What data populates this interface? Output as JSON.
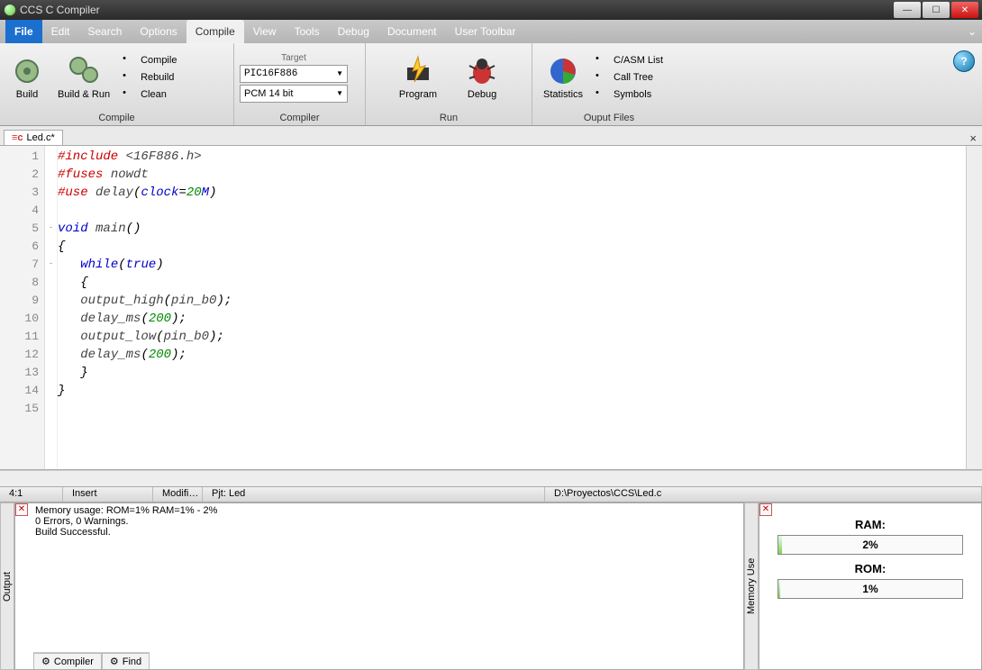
{
  "titlebar": {
    "title": "CCS C Compiler"
  },
  "menu": {
    "file": "File",
    "items": [
      "Edit",
      "Search",
      "Options",
      "Compile",
      "View",
      "Tools",
      "Debug",
      "Document",
      "User Toolbar"
    ],
    "active_index": 3
  },
  "ribbon": {
    "groups": {
      "compile": {
        "label": "Compile",
        "build": "Build",
        "build_run": "Build & Run",
        "small": [
          "Compile",
          "Rebuild",
          "Clean"
        ]
      },
      "compiler": {
        "label": "Compiler",
        "target_label": "Target",
        "target_value": "PIC16F886",
        "mode_value": "PCM 14 bit"
      },
      "run": {
        "label": "Run",
        "program": "Program",
        "debug": "Debug"
      },
      "output": {
        "label": "Ouput Files",
        "statistics": "Statistics",
        "small": [
          "C/ASM List",
          "Call Tree",
          "Symbols"
        ]
      }
    }
  },
  "tab": {
    "filename": "Led.c*"
  },
  "code": {
    "lines": [
      {
        "n": "1",
        "indent": "",
        "tokens": [
          {
            "t": "#include ",
            "c": "k-red"
          },
          {
            "t": "<16F886.h>",
            "c": "k-fn"
          }
        ]
      },
      {
        "n": "2",
        "indent": "",
        "tokens": [
          {
            "t": "#fuses ",
            "c": "k-red"
          },
          {
            "t": "nowdt",
            "c": "k-fn"
          }
        ]
      },
      {
        "n": "3",
        "indent": "",
        "tokens": [
          {
            "t": "#use ",
            "c": "k-red"
          },
          {
            "t": "delay",
            "c": "k-fn"
          },
          {
            "t": "(",
            "c": ""
          },
          {
            "t": "clock",
            "c": "k-blue"
          },
          {
            "t": "=",
            "c": ""
          },
          {
            "t": "20",
            "c": "k-green"
          },
          {
            "t": "M",
            "c": "k-blue"
          },
          {
            "t": ")",
            "c": ""
          }
        ]
      },
      {
        "n": "4",
        "indent": "",
        "tokens": []
      },
      {
        "n": "5",
        "indent": "",
        "fold": "-",
        "tokens": [
          {
            "t": "void ",
            "c": "k-blue"
          },
          {
            "t": "main",
            "c": "k-fn"
          },
          {
            "t": "()",
            "c": ""
          }
        ]
      },
      {
        "n": "6",
        "indent": "",
        "tokens": [
          {
            "t": "{",
            "c": ""
          }
        ]
      },
      {
        "n": "7",
        "indent": "   ",
        "fold": "-",
        "tokens": [
          {
            "t": "while",
            "c": "k-blue"
          },
          {
            "t": "(",
            "c": ""
          },
          {
            "t": "true",
            "c": "k-blue"
          },
          {
            "t": ")",
            "c": ""
          }
        ]
      },
      {
        "n": "8",
        "indent": "   ",
        "tokens": [
          {
            "t": "{",
            "c": ""
          }
        ]
      },
      {
        "n": "9",
        "indent": "   ",
        "tokens": [
          {
            "t": "output_high",
            "c": "k-fn"
          },
          {
            "t": "(",
            "c": ""
          },
          {
            "t": "pin_b0",
            "c": "k-fn"
          },
          {
            "t": ");",
            "c": ""
          }
        ]
      },
      {
        "n": "10",
        "indent": "   ",
        "tokens": [
          {
            "t": "delay_ms",
            "c": "k-fn"
          },
          {
            "t": "(",
            "c": ""
          },
          {
            "t": "200",
            "c": "k-green"
          },
          {
            "t": ");",
            "c": ""
          }
        ]
      },
      {
        "n": "11",
        "indent": "   ",
        "tokens": [
          {
            "t": "output_low",
            "c": "k-fn"
          },
          {
            "t": "(",
            "c": ""
          },
          {
            "t": "pin_b0",
            "c": "k-fn"
          },
          {
            "t": ");",
            "c": ""
          }
        ]
      },
      {
        "n": "12",
        "indent": "   ",
        "tokens": [
          {
            "t": "delay_ms",
            "c": "k-fn"
          },
          {
            "t": "(",
            "c": ""
          },
          {
            "t": "200",
            "c": "k-green"
          },
          {
            "t": ");",
            "c": ""
          }
        ]
      },
      {
        "n": "13",
        "indent": "   ",
        "tokens": [
          {
            "t": "}",
            "c": ""
          }
        ]
      },
      {
        "n": "14",
        "indent": "",
        "tokens": [
          {
            "t": "}",
            "c": ""
          }
        ]
      },
      {
        "n": "15",
        "indent": "",
        "tokens": []
      }
    ]
  },
  "status": {
    "pos": "4:1",
    "insert": "Insert",
    "modified": "Modifi…",
    "project": "Pjt: Led",
    "path": "D:\\Proyectos\\CCS\\Led.c"
  },
  "output": {
    "label": "Output",
    "lines": [
      "    Memory usage:   ROM=1%      RAM=1% - 2%",
      "    0 Errors,  0 Warnings.",
      "Build Successful."
    ],
    "tabs": [
      "Compiler",
      "Find"
    ]
  },
  "memory": {
    "label": "Memory Use",
    "ram_label": "RAM:",
    "ram_value": "2%",
    "ram_fill": 2,
    "rom_label": "ROM:",
    "rom_value": "1%",
    "rom_fill": 1
  }
}
